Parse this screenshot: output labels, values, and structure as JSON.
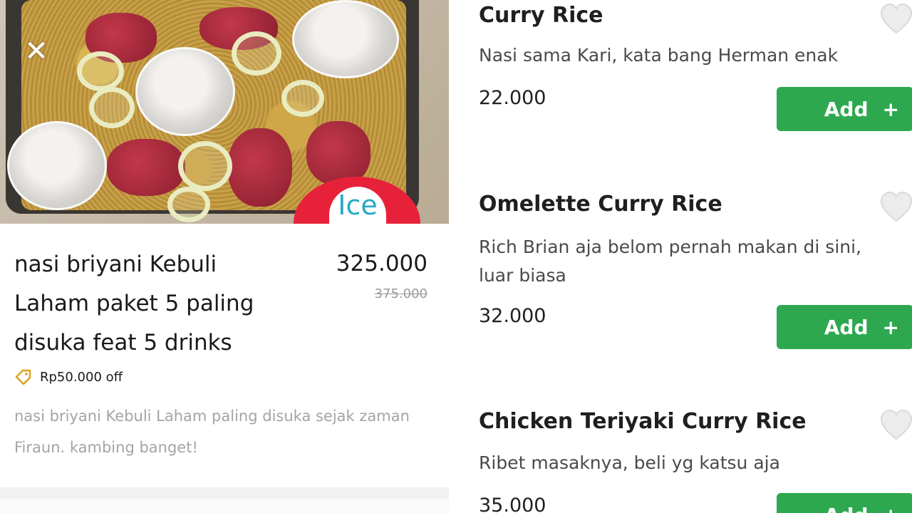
{
  "left_panel": {
    "close_icon": "close-icon",
    "photo_badge": "Ice",
    "product_name": "nasi briyani Kebuli\nLaham  paket 5 paling\ndisuka  feat 5 drinks",
    "price": "325.000",
    "original_price": "375.000",
    "promo_icon": "tag-icon",
    "promo": "Rp50.000 off",
    "description": "nasi briyani Kebuli Laham paling disuka sejak zaman Firaun. kambing banget!"
  },
  "menu": {
    "items": [
      {
        "name": "Curry Rice",
        "description": "Nasi sama Kari, kata bang Herman enak",
        "price": "22.000",
        "add_label": "Add",
        "add_symbol": "+"
      },
      {
        "name": "Omelette Curry Rice",
        "description": "Rich Brian aja belom pernah makan di sini,\nluar biasa",
        "price": "32.000",
        "add_label": "Add",
        "add_symbol": "+"
      },
      {
        "name": "Chicken Teriyaki Curry Rice",
        "description": "Ribet masaknya, beli yg katsu aja",
        "price": "35.000",
        "add_label": "Add",
        "add_symbol": "+"
      }
    ],
    "heart_icon": "heart-icon"
  },
  "colors": {
    "accent_green": "#2ea84f",
    "badge_red": "#e8213a",
    "muted_gray": "#a4a4a4"
  }
}
